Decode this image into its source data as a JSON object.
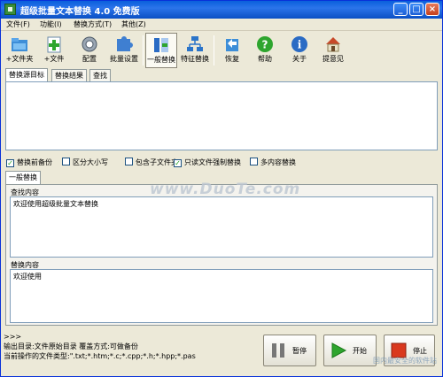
{
  "window": {
    "title": "超级批量文本替换 4.0 免费版",
    "min_glyph": "_",
    "max_glyph": "□",
    "close_glyph": "×"
  },
  "menu": [
    "文件(F)",
    "功能(I)",
    "替换方式(T)",
    "其他(Z)"
  ],
  "toolbar": {
    "add_folder": "+文件夹",
    "add_file": "+文件",
    "config": "配置",
    "batch_settings": "批量设置",
    "general_replace": "一般替换",
    "feature_replace": "特征替换",
    "restore": "恢复",
    "help": "帮助",
    "about": "关于",
    "feedback": "提意见"
  },
  "top_tabs": [
    "替换源目标",
    "替换结果",
    "查找"
  ],
  "options": {
    "backup": "替换前备份",
    "case": "区分大小写",
    "subfolders": "包含子文件夹",
    "readonly": "只读文件强制替换",
    "multi": "多内容替换"
  },
  "checked": {
    "backup": true,
    "case": false,
    "subfolders": false,
    "readonly": true,
    "multi": false
  },
  "replace_tab": "一般替换",
  "find_label": "查找内容",
  "find_value": "欢迎使用超级批量文本替换",
  "replace_label": "替换内容",
  "replace_value": "欢迎使用",
  "status": {
    "prompt": ">>>",
    "line1": "输出目录:文件原始目录    覆盖方式:可做备份",
    "line2": "当前操作的文件类型:\".txt;*.htm;*.c;*.cpp;*.h;*.hpp;*.pas"
  },
  "buttons": {
    "pause": "暂停",
    "start": "开始",
    "stop": "停止"
  },
  "watermark": "www.DuoTe.com",
  "corner_text": "国内最安全的软件站"
}
